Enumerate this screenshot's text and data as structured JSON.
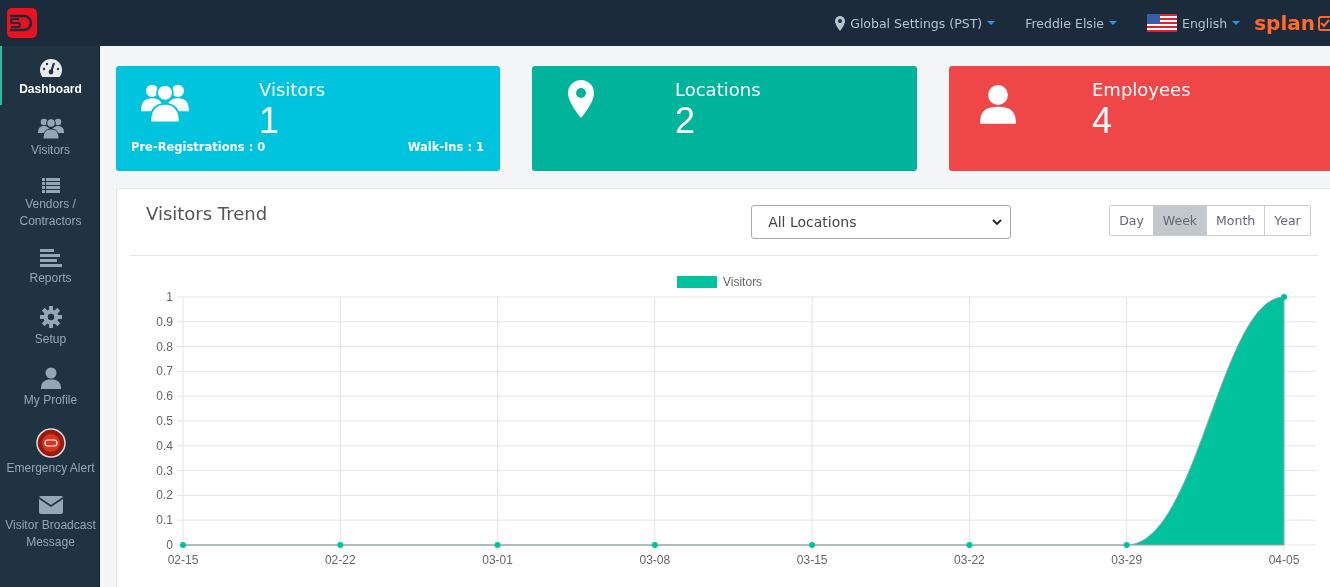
{
  "topbar": {
    "location": "Global Settings (PST)",
    "user": "Freddie Elsie",
    "language": "English",
    "brand": "splan"
  },
  "sidebar": {
    "items": [
      {
        "label": "Dashboard",
        "kind": "gauge",
        "selected": true
      },
      {
        "label": "Visitors",
        "kind": "people",
        "selected": false
      },
      {
        "label": "Vendors / Contractors",
        "kind": "list",
        "selected": false
      },
      {
        "label": "Reports",
        "kind": "lines",
        "selected": false
      },
      {
        "label": "Setup",
        "kind": "gear",
        "selected": false
      },
      {
        "label": "My Profile",
        "kind": "person",
        "selected": false
      },
      {
        "label": "Emergency Alert",
        "kind": "alarm",
        "selected": false
      },
      {
        "label": "Visitor Broadcast Message",
        "kind": "mail",
        "selected": false
      }
    ]
  },
  "cards": [
    {
      "title": "Visitors",
      "count": "1",
      "kind": "people",
      "color": "#00c3de",
      "footer_left": "Pre-Registrations : 0",
      "footer_right": "Walk-Ins : 1"
    },
    {
      "title": "Locations",
      "count": "2",
      "kind": "pin",
      "color": "#00b39b"
    },
    {
      "title": "Employees",
      "count": "4",
      "kind": "person",
      "color": "#ef4747"
    }
  ],
  "trend": {
    "title": "Visitors Trend",
    "location_select": "All Locations",
    "periods": [
      {
        "label": "Day",
        "selected": false
      },
      {
        "label": "Week",
        "selected": true
      },
      {
        "label": "Month",
        "selected": false
      },
      {
        "label": "Year",
        "selected": false
      }
    ],
    "chart_data": {
      "type": "area",
      "grid": true,
      "categories": [
        "02-15",
        "02-22",
        "03-01",
        "03-08",
        "03-15",
        "03-22",
        "03-29",
        "04-05"
      ],
      "series": [
        {
          "name": "Visitors",
          "color": "#00c29d",
          "values": [
            0,
            0,
            0,
            0,
            0,
            0,
            0,
            1
          ]
        }
      ],
      "ylim": [
        0,
        1
      ],
      "yticks": [
        0,
        0.1,
        0.2,
        0.3,
        0.4,
        0.5,
        0.6,
        0.7,
        0.8,
        0.9,
        1
      ]
    }
  }
}
